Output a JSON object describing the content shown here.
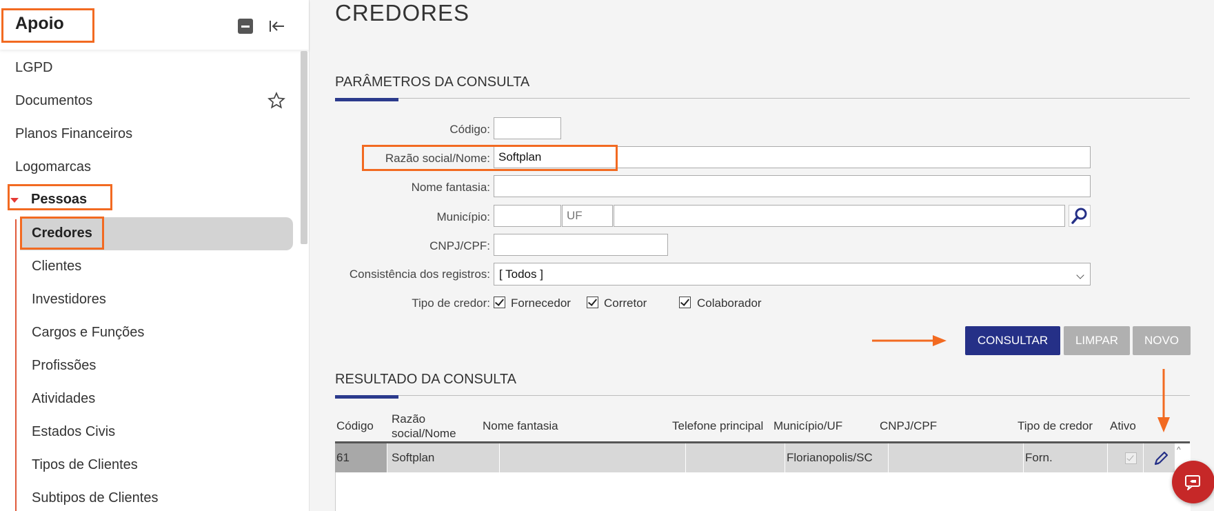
{
  "sidebar": {
    "title": "Apoio",
    "items": [
      {
        "label": "LGPD"
      },
      {
        "label": "Documentos"
      },
      {
        "label": "Planos Financeiros"
      },
      {
        "label": "Logomarcas"
      }
    ],
    "group": {
      "label": "Pessoas",
      "children": [
        {
          "label": "Credores"
        },
        {
          "label": "Clientes"
        },
        {
          "label": "Investidores"
        },
        {
          "label": "Cargos e Funções"
        },
        {
          "label": "Profissões"
        },
        {
          "label": "Atividades"
        },
        {
          "label": "Estados Civis"
        },
        {
          "label": "Tipos de Clientes"
        },
        {
          "label": "Subtipos de Clientes"
        }
      ]
    }
  },
  "main": {
    "page_title": "CREDORES",
    "params_title": "PARÂMETROS DA CONSULTA",
    "form": {
      "codigo_label": "Código:",
      "codigo_value": "",
      "razao_label": "Razão social/Nome:",
      "razao_value": "Softplan",
      "fantasia_label": "Nome fantasia:",
      "fantasia_value": "",
      "municipio_label": "Município:",
      "municipio_code": "",
      "uf_placeholder": "UF",
      "municipio_name": "",
      "cnpj_label": "CNPJ/CPF:",
      "cnpj_value": "",
      "consistencia_label": "Consistência dos registros:",
      "consistencia_value": "[ Todos ]",
      "tipo_label": "Tipo de credor:",
      "tipo_options": [
        {
          "label": "Fornecedor",
          "checked": true
        },
        {
          "label": "Corretor",
          "checked": true
        },
        {
          "label": "Colaborador",
          "checked": true
        }
      ]
    },
    "buttons": {
      "consultar": "CONSULTAR",
      "limpar": "LIMPAR",
      "novo": "NOVO"
    },
    "results_title": "RESULTADO DA CONSULTA",
    "table": {
      "headers": [
        "Código",
        "Razão social/Nome",
        "Nome fantasia",
        "Telefone principal",
        "Município/UF",
        "CNPJ/CPF",
        "Tipo de credor",
        "Ativo"
      ],
      "header_razao_line1": "Razão",
      "header_razao_line2": "social/Nome",
      "rows": [
        {
          "codigo": "61",
          "razao": "Softplan",
          "fantasia": "",
          "telefone": "",
          "municipio": "Florianopolis/SC",
          "cnpj": "",
          "tipo": "Forn.",
          "ativo": true
        }
      ]
    }
  },
  "colors": {
    "accent": "#f26a21",
    "primary_button": "#253087",
    "section_accent": "#2b3a8c",
    "chat_button": "#c62828",
    "caret": "#e53935"
  }
}
